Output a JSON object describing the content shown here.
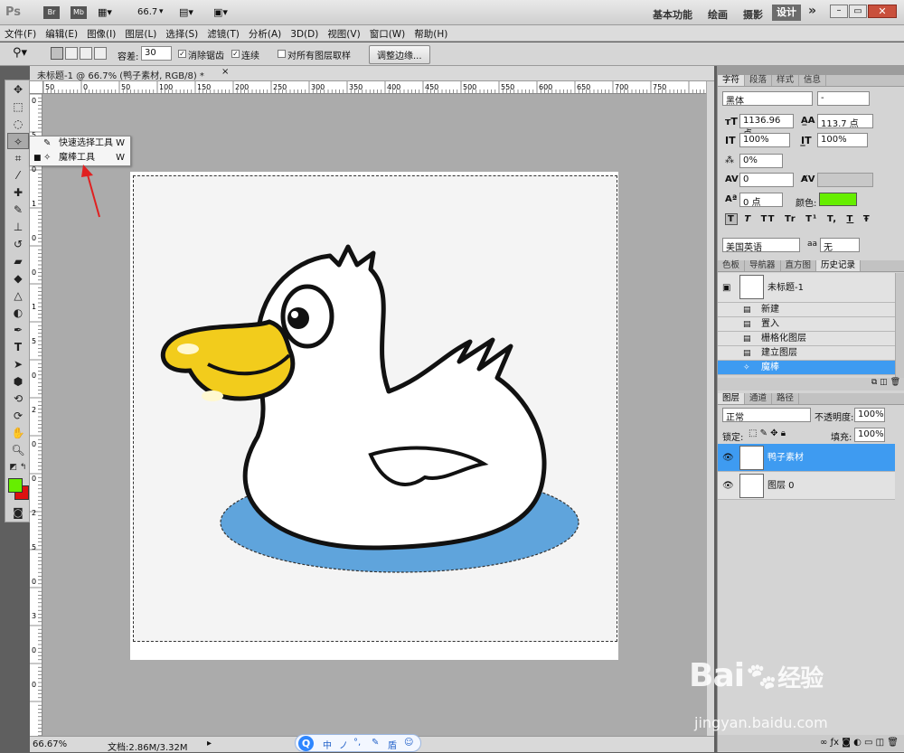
{
  "app_logo": "Ps",
  "appbar": {
    "zoom": "66.7",
    "workspaces": [
      "基本功能",
      "绘画",
      "摄影",
      "设计"
    ],
    "active_workspace": "设计",
    "more": "»"
  },
  "menu": [
    "文件(F)",
    "编辑(E)",
    "图像(I)",
    "图层(L)",
    "选择(S)",
    "滤镜(T)",
    "分析(A)",
    "3D(D)",
    "视图(V)",
    "窗口(W)",
    "帮助(H)"
  ],
  "options": {
    "tolerance_label": "容差:",
    "tolerance_value": "30",
    "antialias": "消除锯齿",
    "contiguous": "连续",
    "all_layers": "对所有图层取样",
    "refine_button": "调整边缘..."
  },
  "document": {
    "tab_title": "未标题-1 @ 66.7% (鸭子素材, RGB/8) *",
    "close": "×"
  },
  "ruler_h": [
    "50",
    "0",
    "50",
    "100",
    "150",
    "200",
    "250",
    "300",
    "350",
    "400",
    "450",
    "500",
    "550",
    "600",
    "650",
    "700",
    "750"
  ],
  "ruler_v": [
    "0",
    "5",
    "0",
    "1",
    "0",
    "0",
    "1",
    "5",
    "0",
    "2",
    "0",
    "0",
    "2",
    "5",
    "0",
    "3",
    "0",
    "0"
  ],
  "flyout": {
    "items": [
      {
        "label": "快速选择工具",
        "key": "W"
      },
      {
        "label": "魔棒工具",
        "key": "W"
      }
    ]
  },
  "status": {
    "zoom": "66.67%",
    "doc": "文档:2.86M/3.32M"
  },
  "char_panel": {
    "tabs": [
      "字符",
      "段落",
      "样式",
      "信息"
    ],
    "font": "黑体",
    "style": "-",
    "size": "1136.96 点",
    "leading": "113.7 点",
    "vscale": "100%",
    "hscale": "100%",
    "tracking_pct": "0%",
    "kerning": "0",
    "baseline": "0 点",
    "color_label": "颜色:",
    "color": "#66ee00",
    "language": "美国英语",
    "aa_label": "aa",
    "aa_value": "无",
    "styles": [
      "T",
      "T",
      "TT",
      "Tr",
      "T¹",
      "T,",
      "T",
      "Ŧ"
    ]
  },
  "history_panel": {
    "tabs": [
      "色板",
      "导航器",
      "直方图",
      "历史记录"
    ],
    "snapshot": "未标题-1",
    "items": [
      "新建",
      "置入",
      "栅格化图层",
      "建立图层",
      "魔棒"
    ]
  },
  "layers_panel": {
    "tabs": [
      "图层",
      "通道",
      "路径"
    ],
    "blend": "正常",
    "opacity_label": "不透明度:",
    "opacity": "100%",
    "lock_label": "锁定:",
    "fill_label": "填充:",
    "fill": "100%",
    "layers": [
      "鸭子素材",
      "图层 0"
    ]
  },
  "watermark": {
    "brand": "Bai",
    "brand2": "经验",
    "url": "jingyan.baidu.com"
  },
  "ime": {
    "items": [
      "中",
      "ノ",
      "°,",
      "✎",
      "盾",
      "☺"
    ]
  }
}
